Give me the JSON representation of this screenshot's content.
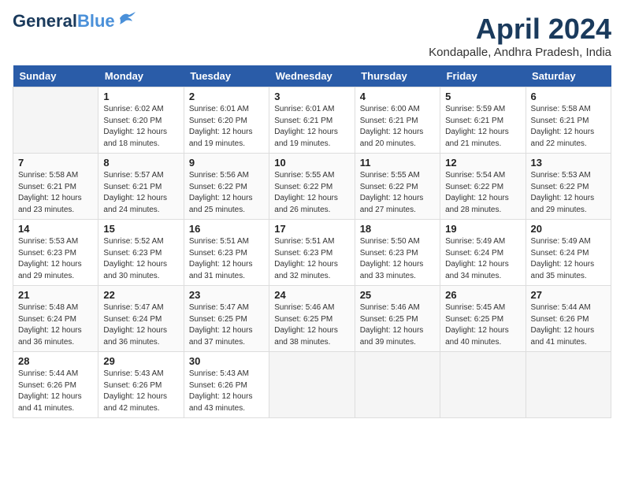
{
  "header": {
    "logo_line1": "General",
    "logo_line2": "Blue",
    "month": "April 2024",
    "location": "Kondapalle, Andhra Pradesh, India"
  },
  "days_of_week": [
    "Sunday",
    "Monday",
    "Tuesday",
    "Wednesday",
    "Thursday",
    "Friday",
    "Saturday"
  ],
  "weeks": [
    [
      {
        "day": "",
        "info": ""
      },
      {
        "day": "1",
        "info": "Sunrise: 6:02 AM\nSunset: 6:20 PM\nDaylight: 12 hours\nand 18 minutes."
      },
      {
        "day": "2",
        "info": "Sunrise: 6:01 AM\nSunset: 6:20 PM\nDaylight: 12 hours\nand 19 minutes."
      },
      {
        "day": "3",
        "info": "Sunrise: 6:01 AM\nSunset: 6:21 PM\nDaylight: 12 hours\nand 19 minutes."
      },
      {
        "day": "4",
        "info": "Sunrise: 6:00 AM\nSunset: 6:21 PM\nDaylight: 12 hours\nand 20 minutes."
      },
      {
        "day": "5",
        "info": "Sunrise: 5:59 AM\nSunset: 6:21 PM\nDaylight: 12 hours\nand 21 minutes."
      },
      {
        "day": "6",
        "info": "Sunrise: 5:58 AM\nSunset: 6:21 PM\nDaylight: 12 hours\nand 22 minutes."
      }
    ],
    [
      {
        "day": "7",
        "info": "Sunrise: 5:58 AM\nSunset: 6:21 PM\nDaylight: 12 hours\nand 23 minutes."
      },
      {
        "day": "8",
        "info": "Sunrise: 5:57 AM\nSunset: 6:21 PM\nDaylight: 12 hours\nand 24 minutes."
      },
      {
        "day": "9",
        "info": "Sunrise: 5:56 AM\nSunset: 6:22 PM\nDaylight: 12 hours\nand 25 minutes."
      },
      {
        "day": "10",
        "info": "Sunrise: 5:55 AM\nSunset: 6:22 PM\nDaylight: 12 hours\nand 26 minutes."
      },
      {
        "day": "11",
        "info": "Sunrise: 5:55 AM\nSunset: 6:22 PM\nDaylight: 12 hours\nand 27 minutes."
      },
      {
        "day": "12",
        "info": "Sunrise: 5:54 AM\nSunset: 6:22 PM\nDaylight: 12 hours\nand 28 minutes."
      },
      {
        "day": "13",
        "info": "Sunrise: 5:53 AM\nSunset: 6:22 PM\nDaylight: 12 hours\nand 29 minutes."
      }
    ],
    [
      {
        "day": "14",
        "info": "Sunrise: 5:53 AM\nSunset: 6:23 PM\nDaylight: 12 hours\nand 29 minutes."
      },
      {
        "day": "15",
        "info": "Sunrise: 5:52 AM\nSunset: 6:23 PM\nDaylight: 12 hours\nand 30 minutes."
      },
      {
        "day": "16",
        "info": "Sunrise: 5:51 AM\nSunset: 6:23 PM\nDaylight: 12 hours\nand 31 minutes."
      },
      {
        "day": "17",
        "info": "Sunrise: 5:51 AM\nSunset: 6:23 PM\nDaylight: 12 hours\nand 32 minutes."
      },
      {
        "day": "18",
        "info": "Sunrise: 5:50 AM\nSunset: 6:23 PM\nDaylight: 12 hours\nand 33 minutes."
      },
      {
        "day": "19",
        "info": "Sunrise: 5:49 AM\nSunset: 6:24 PM\nDaylight: 12 hours\nand 34 minutes."
      },
      {
        "day": "20",
        "info": "Sunrise: 5:49 AM\nSunset: 6:24 PM\nDaylight: 12 hours\nand 35 minutes."
      }
    ],
    [
      {
        "day": "21",
        "info": "Sunrise: 5:48 AM\nSunset: 6:24 PM\nDaylight: 12 hours\nand 36 minutes."
      },
      {
        "day": "22",
        "info": "Sunrise: 5:47 AM\nSunset: 6:24 PM\nDaylight: 12 hours\nand 36 minutes."
      },
      {
        "day": "23",
        "info": "Sunrise: 5:47 AM\nSunset: 6:25 PM\nDaylight: 12 hours\nand 37 minutes."
      },
      {
        "day": "24",
        "info": "Sunrise: 5:46 AM\nSunset: 6:25 PM\nDaylight: 12 hours\nand 38 minutes."
      },
      {
        "day": "25",
        "info": "Sunrise: 5:46 AM\nSunset: 6:25 PM\nDaylight: 12 hours\nand 39 minutes."
      },
      {
        "day": "26",
        "info": "Sunrise: 5:45 AM\nSunset: 6:25 PM\nDaylight: 12 hours\nand 40 minutes."
      },
      {
        "day": "27",
        "info": "Sunrise: 5:44 AM\nSunset: 6:26 PM\nDaylight: 12 hours\nand 41 minutes."
      }
    ],
    [
      {
        "day": "28",
        "info": "Sunrise: 5:44 AM\nSunset: 6:26 PM\nDaylight: 12 hours\nand 41 minutes."
      },
      {
        "day": "29",
        "info": "Sunrise: 5:43 AM\nSunset: 6:26 PM\nDaylight: 12 hours\nand 42 minutes."
      },
      {
        "day": "30",
        "info": "Sunrise: 5:43 AM\nSunset: 6:26 PM\nDaylight: 12 hours\nand 43 minutes."
      },
      {
        "day": "",
        "info": ""
      },
      {
        "day": "",
        "info": ""
      },
      {
        "day": "",
        "info": ""
      },
      {
        "day": "",
        "info": ""
      }
    ]
  ]
}
